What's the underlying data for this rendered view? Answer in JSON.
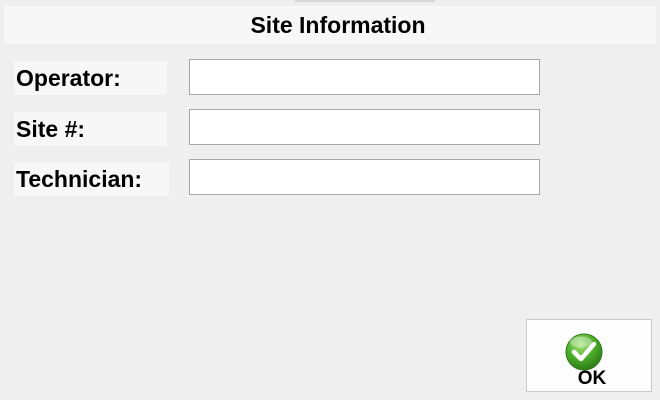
{
  "dialog": {
    "title": "Site Information"
  },
  "form": {
    "fields": [
      {
        "label": "Operator:",
        "value": ""
      },
      {
        "label": "Site #:",
        "value": ""
      },
      {
        "label": "Technician:",
        "value": ""
      }
    ]
  },
  "buttons": {
    "ok_label": "OK",
    "ok_icon": "checkmark-circle-icon"
  },
  "colors": {
    "background": "#efefef",
    "header_background": "#f7f7f7",
    "field_border": "#a9a9a9",
    "ok_icon_green": "#4caf2a"
  }
}
